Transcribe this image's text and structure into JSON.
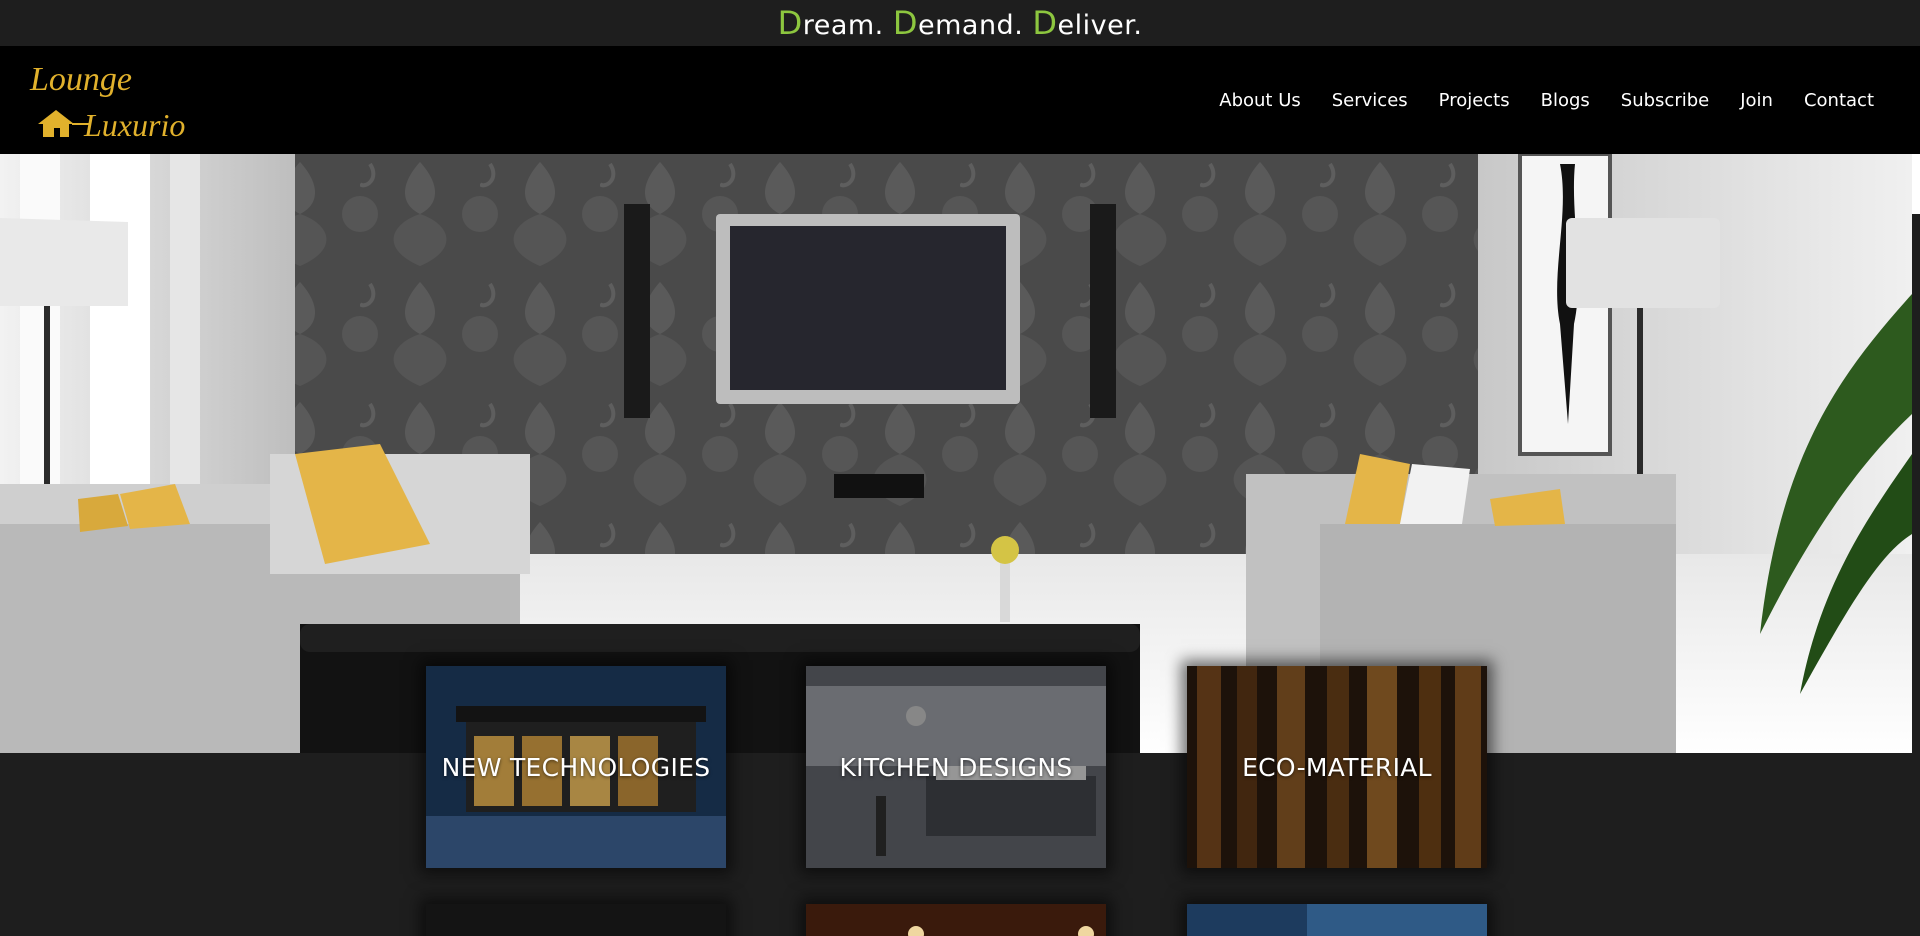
{
  "tagline": {
    "parts": [
      {
        "initial": "D",
        "rest": "ream. "
      },
      {
        "initial": "D",
        "rest": "emand. "
      },
      {
        "initial": "D",
        "rest": "eliver."
      }
    ]
  },
  "logo": {
    "text_line1": "Lounge",
    "text_line2": "Luxurio"
  },
  "nav": {
    "items": [
      "About Us",
      "Services",
      "Projects",
      "Blogs",
      "Subscribe",
      "Join",
      "Contact"
    ]
  },
  "cards": [
    {
      "label": "NEW TECHNOLOGIES"
    },
    {
      "label": "KITCHEN DESIGNS"
    },
    {
      "label": "ECO-MATERIAL"
    }
  ],
  "colors": {
    "accent": "#8dc63f",
    "logo_gold": "#e1b12c",
    "header_bg": "#000000",
    "page_bg": "#1e1e1e"
  }
}
